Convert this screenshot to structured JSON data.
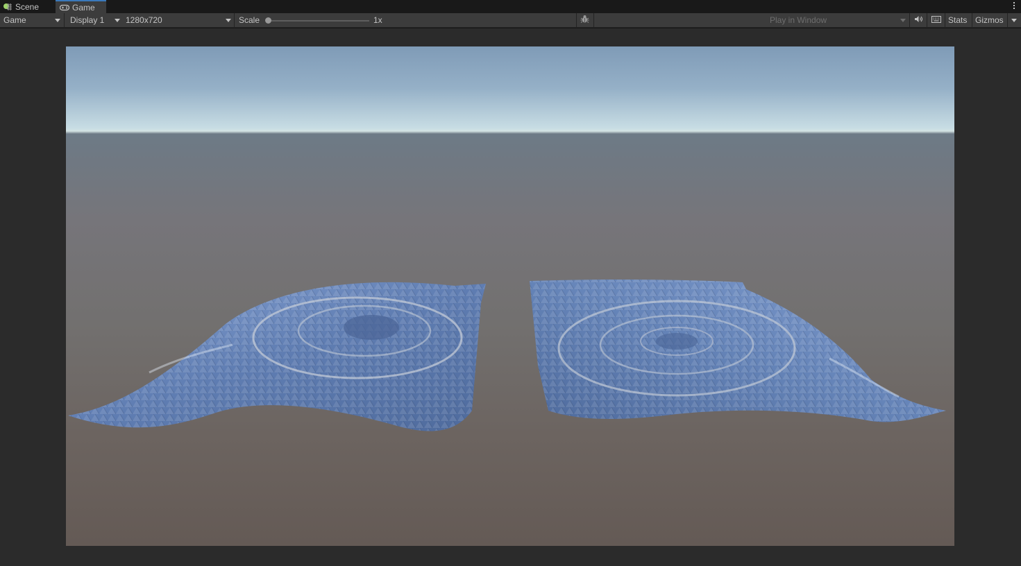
{
  "tabs": [
    {
      "label": "Scene",
      "icon": "scene-grid-icon",
      "active": false
    },
    {
      "label": "Game",
      "icon": "gamepad-icon",
      "active": true
    }
  ],
  "toolbar": {
    "view_select": "Game",
    "display_select": "Display 1",
    "resolution_select": "1280x720",
    "scale_label": "Scale",
    "scale_value": "1x",
    "scale_fraction": 0,
    "play_mode_select": "Play in Window",
    "stats_label": "Stats",
    "gizmos_label": "Gizmos"
  },
  "icons": {
    "debug": "bug-icon",
    "mute": "speaker-icon",
    "shortcuts": "keyboard-icon",
    "menu": "kebab-menu-icon"
  },
  "colors": {
    "active_tab_accent": "#3a79bb",
    "mesh_blue": "#6a8ac0"
  }
}
